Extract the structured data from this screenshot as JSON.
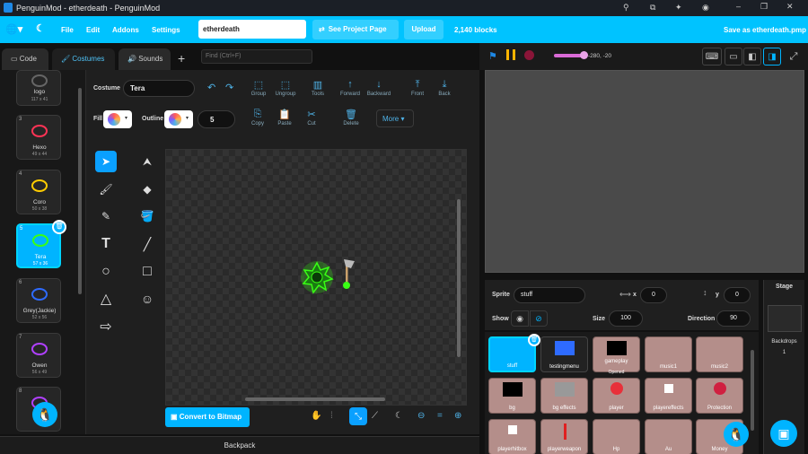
{
  "window": {
    "title": "PenguinMod - etherdeath - PenguinMod"
  },
  "menubar": {
    "file": "File",
    "edit": "Edit",
    "addons": "Addons",
    "settings": "Settings",
    "project_name": "etherdeath",
    "see_project_page": "See Project Page",
    "upload": "Upload",
    "blocks_count": "2,140 blocks",
    "save_as": "Save as etherdeath.pmp"
  },
  "tabs": {
    "code": "Code",
    "costumes": "Costumes",
    "sounds": "Sounds",
    "find_placeholder": "Find (Ctrl+F)"
  },
  "costumes": [
    {
      "num": "",
      "name": "logo",
      "size": "117 x 41"
    },
    {
      "num": "3",
      "name": "Hexo",
      "size": "49 x 44"
    },
    {
      "num": "4",
      "name": "Coro",
      "size": "50 x 38"
    },
    {
      "num": "5",
      "name": "Tera",
      "size": "57 x 36",
      "selected": true
    },
    {
      "num": "6",
      "name": "Grey(Jackie)",
      "size": "52 x 56"
    },
    {
      "num": "7",
      "name": "Owen",
      "size": "56 x 49"
    },
    {
      "num": "8",
      "name": "",
      "size": ""
    }
  ],
  "editor": {
    "costume_label": "Costume",
    "costume_name": "Tera",
    "fill_label": "Fill",
    "outline_label": "Outline",
    "outline_width": "5",
    "tools": {
      "group": "Group",
      "ungroup": "Ungroup",
      "tools": "Tools",
      "forward": "Forward",
      "backward": "Backward",
      "front": "Front",
      "back": "Back",
      "copy": "Copy",
      "paste": "Paste",
      "cut": "Cut",
      "delete": "Delete",
      "more": "More"
    },
    "convert_button": "Convert to Bitmap"
  },
  "stage_controls": {
    "coords": "-280, -20"
  },
  "sprite_info": {
    "sprite_label": "Sprite",
    "sprite_name": "stuff",
    "x_label": "x",
    "x": "0",
    "y_label": "y",
    "y": "0",
    "show_label": "Show",
    "size_label": "Size",
    "size": "100",
    "direction_label": "Direction",
    "direction": "90"
  },
  "sprites": [
    {
      "name": "stuff",
      "selected": true
    },
    {
      "name": "testingmenu"
    },
    {
      "name": "gameplay",
      "sub": "Opened"
    },
    {
      "name": "music1"
    },
    {
      "name": "music2"
    },
    {
      "name": "bg"
    },
    {
      "name": "bg effects"
    },
    {
      "name": "player"
    },
    {
      "name": "playereffects"
    },
    {
      "name": "Protection"
    },
    {
      "name": "playerhitbox"
    },
    {
      "name": "playerweapon"
    },
    {
      "name": "Hp"
    },
    {
      "name": "Au"
    },
    {
      "name": "Money"
    }
  ],
  "stage_panel": {
    "title": "Stage",
    "backdrops_label": "Backdrops",
    "backdrops_count": "1"
  },
  "backpack": "Backpack",
  "colors": {
    "accent": "#00c3ff",
    "selected": "#00b4ff",
    "sprite_card": "#b48e8a"
  }
}
